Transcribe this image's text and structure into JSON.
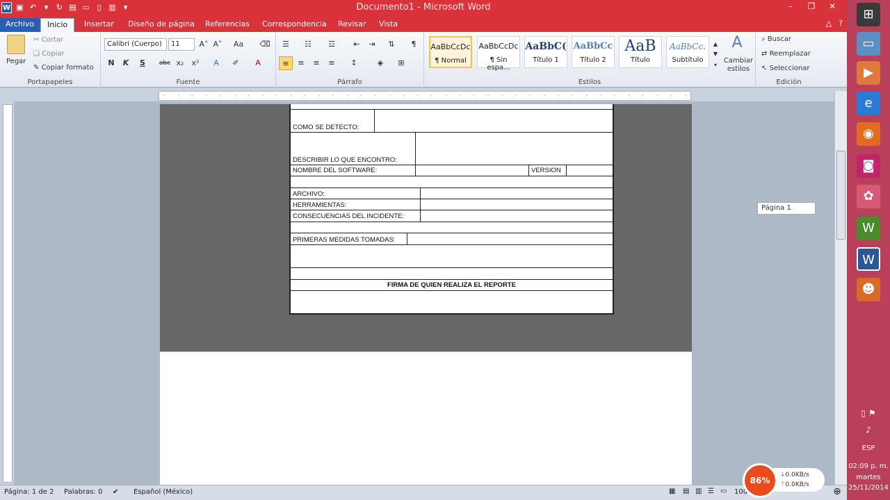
{
  "window": {
    "title": "Documento1  -  Microsoft Word"
  },
  "tabs": [
    "Archivo",
    "Inicio",
    "Insertar",
    "Diseño de página",
    "Referencias",
    "Correspondencia",
    "Revisar",
    "Vista"
  ],
  "clipboard": {
    "paste": "Pegar",
    "cut": "Cortar",
    "copy": "Copiar",
    "format_painter": "Copiar formato",
    "label": "Portapapeles"
  },
  "font": {
    "family": "Calibri (Cuerpo)",
    "size": "11",
    "label": "Fuente",
    "bold": "N",
    "italic": "K",
    "underline": "S",
    "strike": "abc"
  },
  "paragraph": {
    "label": "Párrafo"
  },
  "styles": {
    "label": "Estilos",
    "items": [
      {
        "sample": "AaBbCcDc",
        "name": "¶ Normal"
      },
      {
        "sample": "AaBbCcDc",
        "name": "¶ Sin espa..."
      },
      {
        "sample": "AaBbC(",
        "name": "Título 1"
      },
      {
        "sample": "AaBbCc",
        "name": "Título 2"
      },
      {
        "sample": "AaB",
        "name": "Título"
      },
      {
        "sample": "AaBbCc.",
        "name": "Subtítulo"
      }
    ],
    "change": "Cambiar estilos"
  },
  "editing": {
    "label": "Edición",
    "find": "Buscar",
    "replace": "Reemplazar",
    "select": "Seleccionar"
  },
  "form": {
    "como": "COMO SE DETECTO:",
    "describir": "DESCRIBIR LO QUE ENCONTRO:",
    "software": "NOMBRE DEL SOFTWARE:",
    "version": "VERSION",
    "archivo": "ARCHIVO:",
    "herramientas": "HERRAMIENTAS:",
    "consecuencias": "CONSECUENCIAS DEL INCIDENTE:",
    "primeras": "PRIMERAS MEDIDAS TOMADAS:",
    "firma": "FIRMA DE QUIEN REALIZA EL REPORTE"
  },
  "tooltip": "Página 1",
  "status": {
    "page": "Página: 1 de 2",
    "words": "Palabras: 0",
    "language": "Español (México)",
    "zoom": "100"
  },
  "net": {
    "percent": "86%",
    "down": "0.0KB/s",
    "up": "0.0KB/s"
  },
  "tray": {
    "lang": "ESP",
    "time": "02:09 p. m.",
    "day": "martes",
    "date": "25/11/2014"
  }
}
